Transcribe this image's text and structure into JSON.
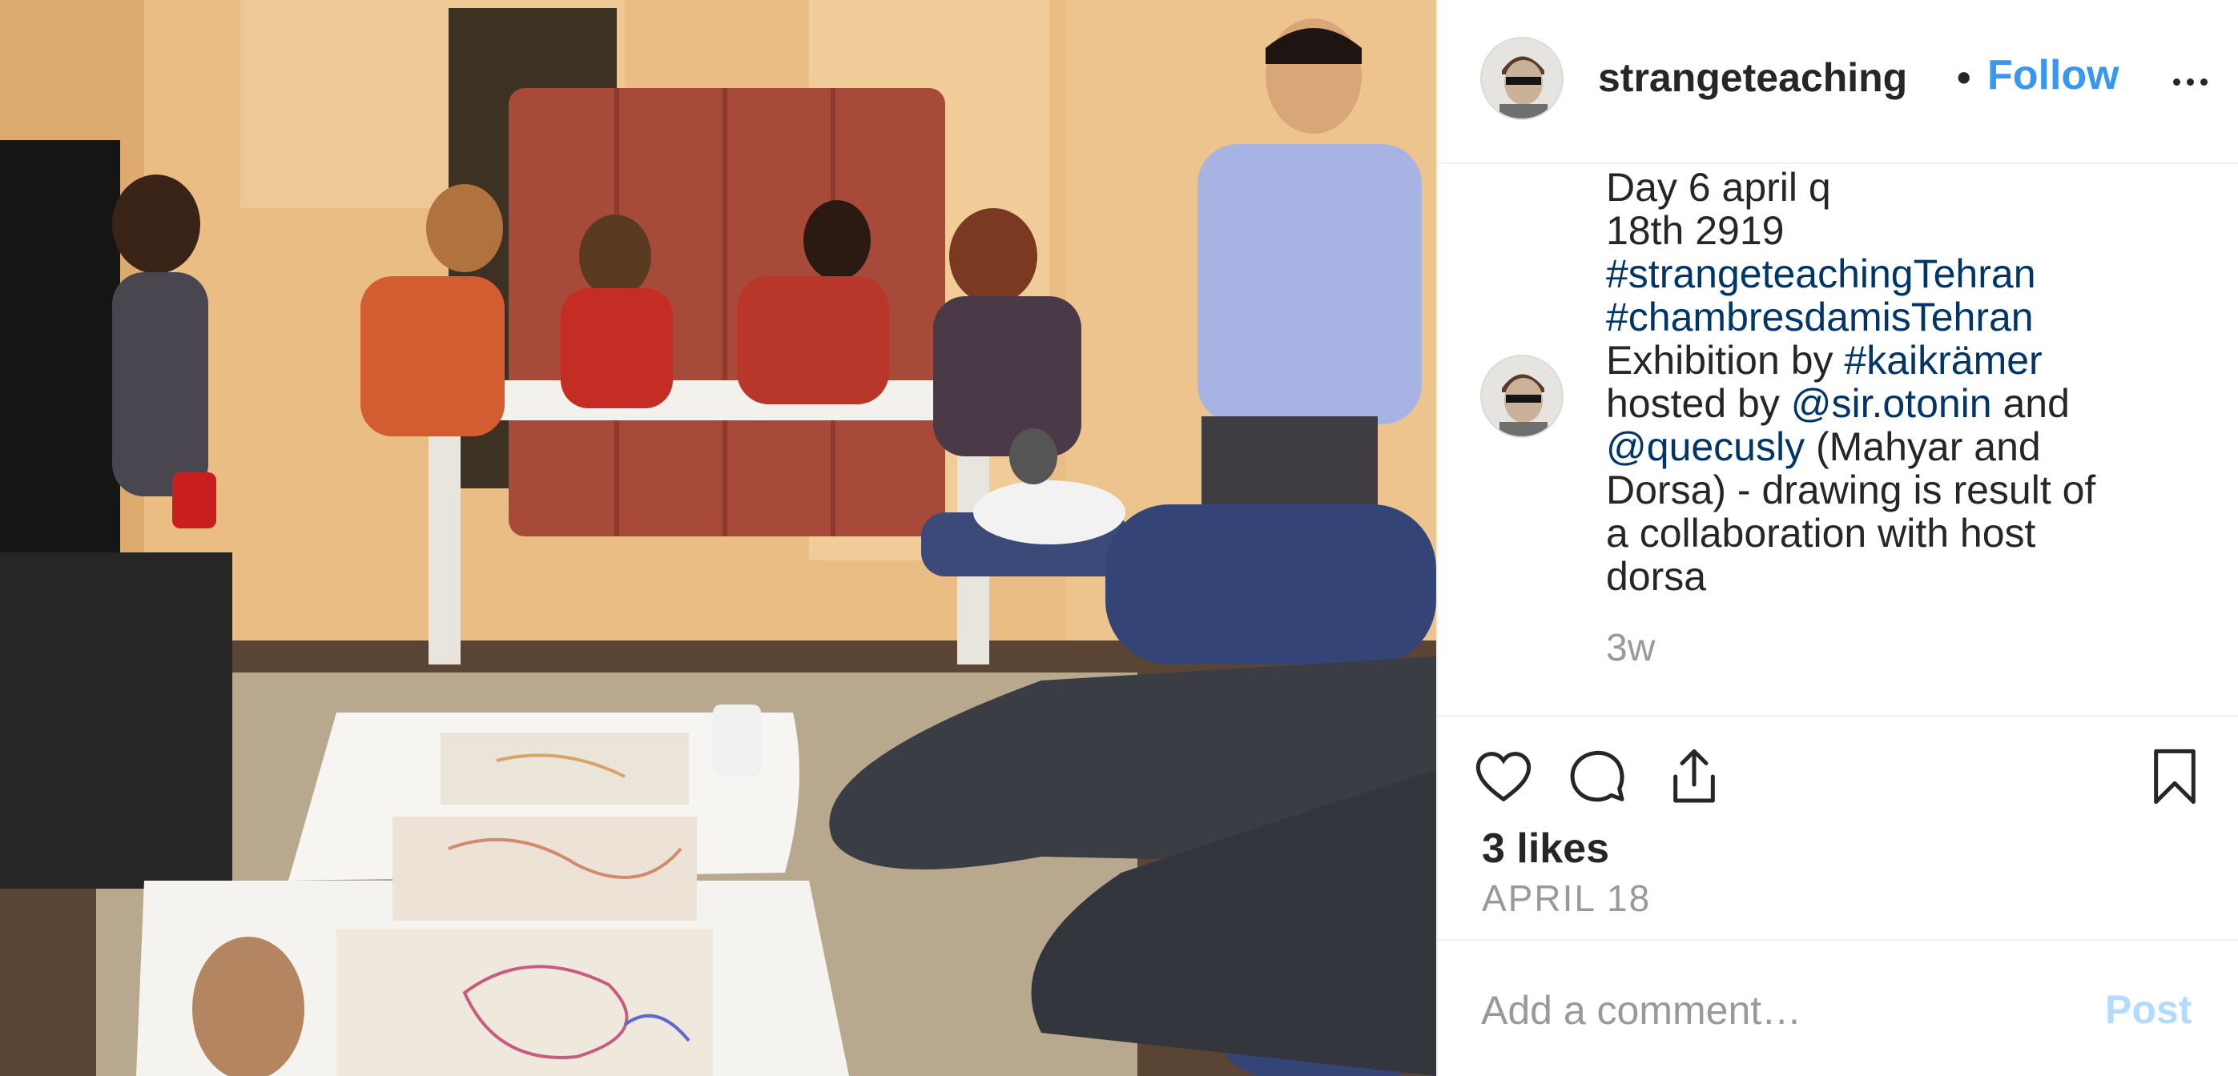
{
  "post": {
    "username": "strangeteaching",
    "separator": "•",
    "follow_label": "Follow",
    "more_icon": "more-options-icon"
  },
  "caption": {
    "lines": [
      [
        {
          "t": "Day 6 april q"
        }
      ],
      [
        {
          "t": "18th 2919"
        }
      ],
      [
        {
          "t": "#strangeteachingTehran",
          "tag": true
        }
      ],
      [
        {
          "t": "#chambresdamisTehran",
          "tag": true
        }
      ],
      [
        {
          "t": "Exhibition by "
        },
        {
          "t": "#kaikrämer",
          "tag": true
        }
      ],
      [
        {
          "t": "hosted by "
        },
        {
          "t": "@sir.otonin",
          "tag": true
        },
        {
          "t": " and"
        }
      ],
      [
        {
          "t": "@quecusly",
          "tag": true
        },
        {
          "t": " (Mahyar and"
        }
      ],
      [
        {
          "t": "Dorsa) - drawing is result of"
        }
      ],
      [
        {
          "t": "a collaboration with host"
        }
      ],
      [
        {
          "t": "dorsa"
        }
      ]
    ],
    "time_ago": "3w"
  },
  "actions": {
    "like_icon": "heart-icon",
    "comment_icon": "comment-icon",
    "share_icon": "share-icon",
    "save_icon": "bookmark-icon"
  },
  "likes_text": "3 likes",
  "date_text": "APRIL 18",
  "comment": {
    "placeholder": "Add a comment…",
    "post_label": "Post"
  },
  "colors": {
    "link": "#3897f0",
    "hashtag": "#003569",
    "muted": "#999999",
    "post_disabled": "#b3dbff"
  }
}
